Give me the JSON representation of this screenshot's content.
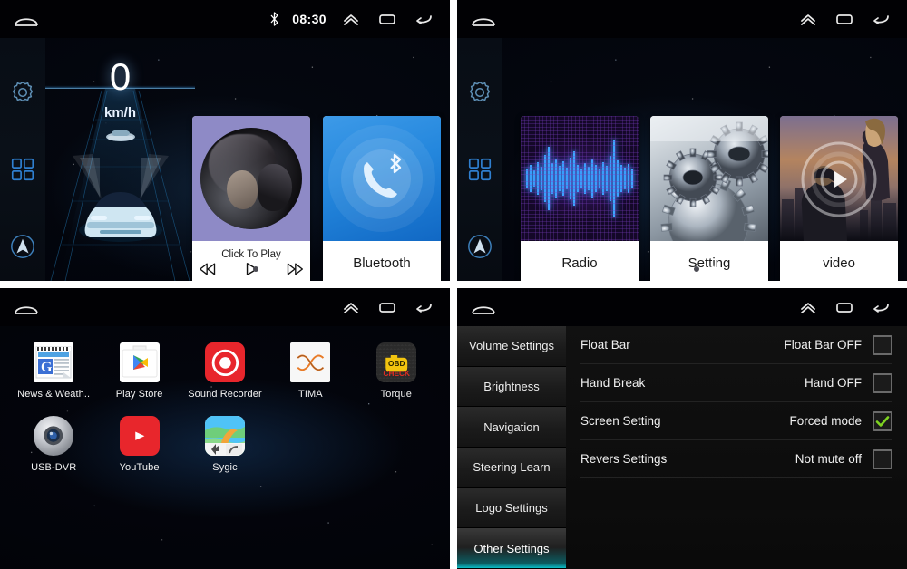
{
  "panels": {
    "home_music": {
      "statusbar": {
        "bluetooth_icon": "bluetooth-icon",
        "time": "08:30",
        "expand_icon": "chevron-up-icon",
        "recents_icon": "recents-icon",
        "back_icon": "back-icon",
        "home_icon": "home-icon"
      },
      "rail": [
        {
          "name": "settings-gear",
          "icon": "gear-icon"
        },
        {
          "name": "apps-grid",
          "icon": "grid-icon"
        },
        {
          "name": "navigation",
          "icon": "navigation-arrow-icon"
        }
      ],
      "speedometer": {
        "value": "0",
        "unit": "km/h"
      },
      "music_widget": {
        "label": "Click To Play",
        "prev": "previous-track-icon",
        "play": "play-icon",
        "next": "next-track-icon"
      },
      "bluetooth_widget": {
        "label": "Bluetooth",
        "icon": "bluetooth-phone-icon"
      },
      "pager": {
        "count": 2,
        "active": 0
      }
    },
    "home_media": {
      "statusbar": {
        "expand_icon": "chevron-up-icon",
        "recents_icon": "recents-icon",
        "back_icon": "back-icon",
        "home_icon": "home-icon"
      },
      "rail": [
        {
          "name": "settings-gear",
          "icon": "gear-icon"
        },
        {
          "name": "apps-grid",
          "icon": "grid-icon"
        },
        {
          "name": "navigation",
          "icon": "navigation-arrow-icon"
        }
      ],
      "tiles": [
        {
          "label": "Radio",
          "art": "audio-waveform"
        },
        {
          "label": "Setting",
          "art": "gears-photo"
        },
        {
          "label": "video",
          "art": "movie-poster-with-play"
        }
      ],
      "pager": {
        "count": 2,
        "active": 1
      }
    },
    "app_drawer": {
      "statusbar": {
        "expand_icon": "chevron-up-icon",
        "recents_icon": "recents-icon",
        "back_icon": "back-icon",
        "home_icon": "home-icon"
      },
      "apps": [
        {
          "label": "News & Weath..",
          "icon": "news-weather-icon"
        },
        {
          "label": "Play Store",
          "icon": "play-store-icon"
        },
        {
          "label": "Sound Recorder",
          "icon": "sound-recorder-icon"
        },
        {
          "label": "TIMA",
          "icon": "tima-icon"
        },
        {
          "label": "Torque",
          "icon": "torque-obd-icon"
        },
        {
          "label": "USB-DVR",
          "icon": "usb-dvr-icon"
        },
        {
          "label": "YouTube",
          "icon": "youtube-icon"
        },
        {
          "label": "Sygic",
          "icon": "sygic-icon"
        }
      ]
    },
    "settings": {
      "statusbar": {
        "expand_icon": "chevron-up-icon",
        "recents_icon": "recents-icon",
        "back_icon": "back-icon",
        "home_icon": "home-icon"
      },
      "tabs": [
        {
          "label": "Volume Settings",
          "active": false
        },
        {
          "label": "Brightness",
          "active": false
        },
        {
          "label": "Navigation",
          "active": false
        },
        {
          "label": "Steering Learn",
          "active": false
        },
        {
          "label": "Logo Settings",
          "active": false
        },
        {
          "label": "Other Settings",
          "active": true
        }
      ],
      "rows": [
        {
          "name": "Float Bar",
          "value": "Float Bar OFF",
          "checked": false
        },
        {
          "name": "Hand Break",
          "value": "Hand OFF",
          "checked": false
        },
        {
          "name": "Screen Setting",
          "value": "Forced mode",
          "checked": true
        },
        {
          "name": "Revers Settings",
          "value": "Not mute off",
          "checked": false
        }
      ],
      "accent_color": "#0bbfc9",
      "check_color": "#7ed321"
    }
  }
}
